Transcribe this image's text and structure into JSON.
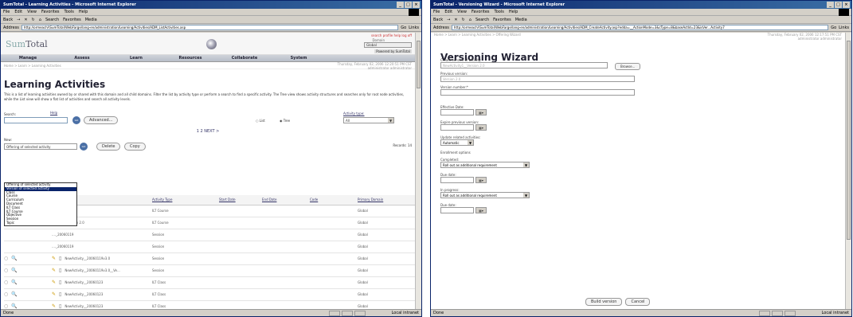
{
  "left": {
    "title": "SumTotal - Learning Activities - Microsoft Internet Explorer",
    "menu": [
      "File",
      "Edit",
      "View",
      "Favorites",
      "Tools",
      "Help"
    ],
    "toolbar": [
      "Back",
      "Search",
      "Favorites",
      "Media"
    ],
    "address_label": "Address",
    "address": "http://ormeach/\\SumTotal\\WebFarge/lang-en/administration/Learning/Activities/ADM_ListActivities.asp",
    "go": "Go",
    "links": "Links",
    "logo_a": "Sum",
    "logo_b": "Total",
    "toplinks": "search  profile  help  log off",
    "domain_label": "Domain",
    "domain_value": "Global",
    "powered": "Powered by SumTotal",
    "nav": [
      "Manage",
      "Assess",
      "Learn",
      "Resources",
      "Collaborate",
      "System"
    ],
    "breadcrumb": "Home > Learn > Learning Activities",
    "date": "Thursday, February 02, 2006 12:20:51 PM CST",
    "user": "administrator administrator",
    "page_title": "Learning Activities",
    "description": "This is a list of learning activities owned by or shared with this domain and all child domains. Filter the list by activity type or perform a search to find a specific activity. The Tree view shows activity structures and searches only for root node activities, while the List view will show a flat list of activities and search all activity levels.",
    "search_label": "Search:",
    "help": "Help",
    "go_btn": "GO",
    "advanced": "Advanced...",
    "view_list": "List",
    "view_tree": "Tree",
    "activity_type_label": "Activity type:",
    "activity_type_value": "All",
    "pager": "1 2  NEXT >",
    "new_label": "New:",
    "new_value": "Offering of selected activity",
    "delete": "Delete",
    "copy": "Copy",
    "records": "Records: 14",
    "dropdown": [
      "Offering of selected activity",
      "Version of selected activity",
      "Class",
      "Course",
      "Curriculum",
      "Document",
      "ILT Class",
      "ILT Course",
      "Objective",
      "Session",
      "Topic"
    ],
    "columns": [
      "",
      "Name",
      "Activity Type",
      "Start Date",
      "End Date",
      "Code",
      "Primary Domain"
    ],
    "rows": [
      {
        "name": "...tivity1",
        "type": "ILT Course",
        "domain": "Global"
      },
      {
        "name": "...tivity1_Version 2.0",
        "type": "ILT Course",
        "domain": "Global"
      },
      {
        "name": "...._20060119",
        "type": "Session",
        "domain": "Global"
      },
      {
        "name": "...._20060119",
        "type": "Session",
        "domain": "Global"
      },
      {
        "name": "NewActivity__20060119v3.0",
        "type": "Session",
        "domain": "Global"
      },
      {
        "name": "NewActivity__20060119v3.0__Ve...",
        "type": "Session",
        "domain": "Global"
      },
      {
        "name": "NewActivity__20060123",
        "type": "ILT Class",
        "domain": "Global"
      },
      {
        "name": "NewActivity__20060123",
        "type": "ILT Class",
        "domain": "Global"
      },
      {
        "name": "NewActivity__20060123",
        "type": "ILT Class",
        "domain": "Global"
      }
    ],
    "status": "Done",
    "zone": "Local intranet"
  },
  "right": {
    "title": "SumTotal - Versioning Wizard - Microsoft Internet Explorer",
    "menu": [
      "File",
      "Edit",
      "View",
      "Favorites",
      "Tools",
      "Help"
    ],
    "toolbar": [
      "Back",
      "Search",
      "Favorites",
      "Media"
    ],
    "address_label": "Address",
    "address": "http://ormeach/\\SumTotal\\WebFarge/lang-en/administration/Learning/Activities/ADM_CreateActivity.asp?edda=__ActionMode=3&cType=8&baseActId=23&isVer...Activity7",
    "go": "Go",
    "links": "Links",
    "breadcrumb": "Home > Learn > Learning Activities > Offering Wizard",
    "date": "Thursday, February 02, 2006 12:17:51 PM CST",
    "user": "administrator administrator",
    "wizard_title": "Versioning Wizard",
    "create_label": "Create version of activity:",
    "create_value": "NewActivity1__Version 2.0",
    "browse": "Browse...",
    "prev_label": "Previous version:",
    "prev_value": "Version 2.0",
    "vnum_label": "Version number:*",
    "eff_label": "Effective Date:",
    "expire_label": "Expire previous version:",
    "update_label": "Update related activities:",
    "update_value": "Automatic",
    "enroll_label": "Enrollment options",
    "completed_label": "Completed:",
    "completed_value": "Roll out as additional requirement",
    "due1_label": "Due date:",
    "inprog_label": "In progress:",
    "inprog_value": "Roll out as additional requirement",
    "due2_label": "Due date:",
    "build": "Build version",
    "cancel": "Cancel",
    "status": "Done",
    "zone": "Local intranet"
  }
}
